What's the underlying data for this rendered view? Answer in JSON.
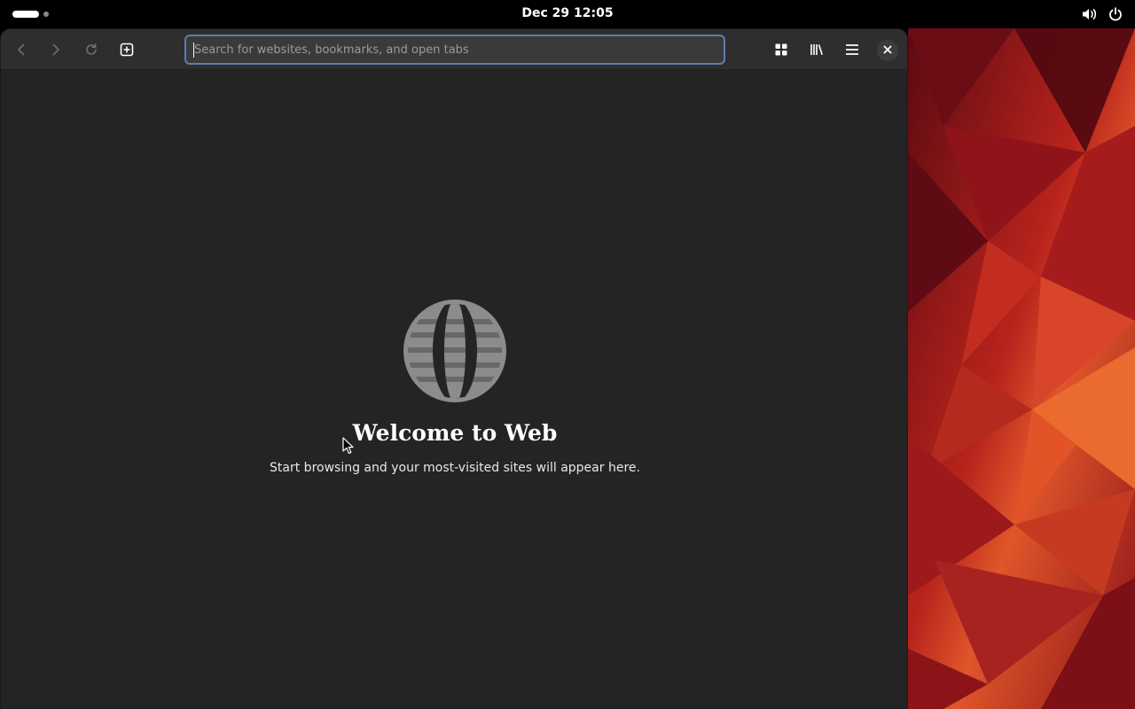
{
  "topbar": {
    "clock": "Dec 29  12:05",
    "icons": [
      "activities-indicator",
      "volume-icon",
      "power-icon"
    ]
  },
  "browser": {
    "toolbar": {
      "back_icon": "chevron-left-icon",
      "forward_icon": "chevron-right-icon",
      "reload_icon": "reload-icon",
      "new_tab_icon": "new-tab-icon",
      "overview_icon": "tab-overview-icon",
      "library_icon": "library-icon",
      "menu_icon": "hamburger-menu-icon",
      "close_icon": "close-icon"
    },
    "url_bar": {
      "placeholder": "Search for websites, bookmarks, and open tabs",
      "value": ""
    },
    "empty_state": {
      "icon": "globe-icon",
      "title": "Welcome to Web",
      "subtitle": "Start browsing and your most-visited sites will appear here."
    }
  },
  "colors": {
    "window_bg": "#242424",
    "headerbar_bg": "#2e2e2e",
    "url_focus_border": "#5b7fae",
    "globe": "#8c8c8c",
    "wallpaper_base": "#7a0f16"
  }
}
